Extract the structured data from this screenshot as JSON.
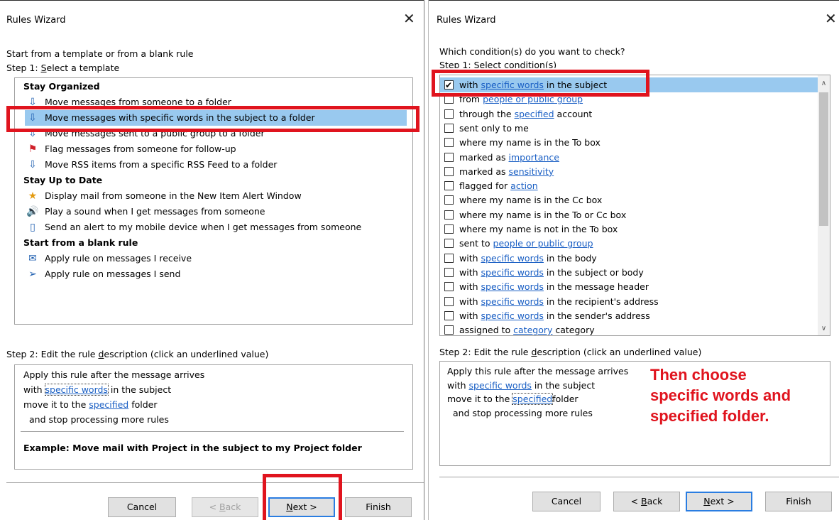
{
  "left": {
    "title": "Rules Wizard",
    "close": "✕",
    "intro": "Start from a template or from a blank rule",
    "step1_prefix": "Step 1: ",
    "step1_u": "S",
    "step1_rest": "elect a template",
    "groups": [
      {
        "label": "Stay Organized",
        "items": [
          {
            "icon": "folder-move-icon",
            "label": "Move messages from someone to a folder"
          },
          {
            "icon": "folder-move-icon",
            "label": "Move messages with specific words in the subject to a folder",
            "selected": true
          },
          {
            "icon": "folder-move-icon",
            "label": "Move messages sent to a public group to a folder"
          },
          {
            "icon": "flag-icon",
            "label": "Flag messages from someone for follow-up"
          },
          {
            "icon": "folder-move-icon",
            "label": "Move RSS items from a specific RSS Feed to a folder"
          }
        ]
      },
      {
        "label": "Stay Up to Date",
        "items": [
          {
            "icon": "alert-window-icon",
            "label": "Display mail from someone in the New Item Alert Window"
          },
          {
            "icon": "speaker-icon",
            "label": "Play a sound when I get messages from someone"
          },
          {
            "icon": "mobile-device-icon",
            "label": "Send an alert to my mobile device when I get messages from someone"
          }
        ]
      },
      {
        "label": "Start from a blank rule",
        "items": [
          {
            "icon": "envelope-icon",
            "label": "Apply rule on messages I receive"
          },
          {
            "icon": "send-icon",
            "label": "Apply rule on messages I send"
          }
        ]
      }
    ],
    "step2_a": "Step 2: Edit the rule ",
    "step2_u": "d",
    "step2_b": "escription (click an underlined value)",
    "desc": {
      "line1": "Apply this rule after the message arrives",
      "line2_a": "with ",
      "line2_link": "specific words",
      "line2_b": " in the subject",
      "line3_a": "move it to the ",
      "line3_link": "specified",
      "line3_b": " folder",
      "line4": "and stop processing more rules",
      "example": "Example: Move mail with Project in the subject to my Project folder"
    },
    "buttons": {
      "cancel": "Cancel",
      "back_a": "< ",
      "back_u": "B",
      "back_b": "ack",
      "next_u": "N",
      "next_b": "ext >",
      "finish": "Finish"
    }
  },
  "right": {
    "title": "Rules Wizard",
    "close": "✕",
    "question": "Which condition(s) do you want to check?",
    "step1": "Step 1: Select condition(s)",
    "conditions": [
      {
        "checked": true,
        "a": "with ",
        "link": "specific words",
        "b": " in the subject"
      },
      {
        "checked": false,
        "a": "from ",
        "link": "people or public group",
        "b": ""
      },
      {
        "checked": false,
        "a": "through the ",
        "link": "specified",
        "b": " account"
      },
      {
        "checked": false,
        "a": "sent only to me",
        "link": "",
        "b": ""
      },
      {
        "checked": false,
        "a": "where my name is in the To box",
        "link": "",
        "b": ""
      },
      {
        "checked": false,
        "a": "marked as ",
        "link": "importance",
        "b": ""
      },
      {
        "checked": false,
        "a": "marked as ",
        "link": "sensitivity",
        "b": ""
      },
      {
        "checked": false,
        "a": "flagged for ",
        "link": "action",
        "b": ""
      },
      {
        "checked": false,
        "a": "where my name is in the Cc box",
        "link": "",
        "b": ""
      },
      {
        "checked": false,
        "a": "where my name is in the To or Cc box",
        "link": "",
        "b": ""
      },
      {
        "checked": false,
        "a": "where my name is not in the To box",
        "link": "",
        "b": ""
      },
      {
        "checked": false,
        "a": "sent to ",
        "link": "people or public group",
        "b": ""
      },
      {
        "checked": false,
        "a": "with ",
        "link": "specific words",
        "b": " in the body"
      },
      {
        "checked": false,
        "a": "with ",
        "link": "specific words",
        "b": " in the subject or body"
      },
      {
        "checked": false,
        "a": "with ",
        "link": "specific words",
        "b": " in the message header"
      },
      {
        "checked": false,
        "a": "with ",
        "link": "specific words",
        "b": " in the recipient's address"
      },
      {
        "checked": false,
        "a": "with ",
        "link": "specific words",
        "b": " in the sender's address"
      },
      {
        "checked": false,
        "a": "assigned to ",
        "link": "category",
        "b": " category"
      }
    ],
    "step2_a": "Step 2: Edit the rule ",
    "step2_u": "d",
    "step2_b": "escription (click an underlined value)",
    "desc": {
      "line1": "Apply this rule after the message arrives",
      "line2_a": "with ",
      "line2_link": "specific words",
      "line2_b": " in the subject",
      "line3_a": "move it to the ",
      "line3_link": "specified",
      "line3_b": "folder",
      "line4": "and stop processing more rules"
    },
    "annotation": "Then choose\nspecific words and\nspecified folder.",
    "buttons": {
      "cancel": "Cancel",
      "back_a": "< ",
      "back_u": "B",
      "back_b": "ack",
      "next_u": "N",
      "next_b": "ext >",
      "finish": "Finish"
    }
  },
  "colors": {
    "highlight": "#99c9ef",
    "annotation_red": "#e0141e",
    "link": "#1a5fc4",
    "default_button_border": "#2a7de1"
  }
}
